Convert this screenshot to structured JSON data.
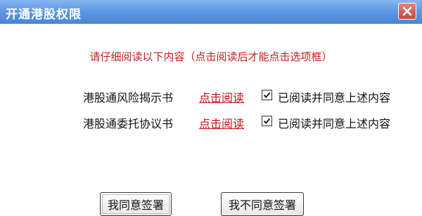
{
  "window": {
    "title": "开通港股权限"
  },
  "notice": "请仔细阅读以下内容（点击阅读后才能点击选项框）",
  "rows": [
    {
      "label": "港股通风险揭示书",
      "link_text": "点击阅读",
      "checkbox_label": "已阅读并同意上述内容",
      "checked": true
    },
    {
      "label": "港股通委托协议书",
      "link_text": "点击阅读",
      "checkbox_label": "已阅读并同意上述内容",
      "checked": true
    }
  ],
  "buttons": {
    "agree": "我同意签署",
    "disagree": "我不同意签署"
  },
  "colors": {
    "title_bar": "#5f98e2",
    "notice_text": "#c41e1e",
    "link_text": "#c0141a",
    "close_button": "#c8463d"
  },
  "icons": {
    "close": "close-icon",
    "check": "checkmark-icon"
  }
}
